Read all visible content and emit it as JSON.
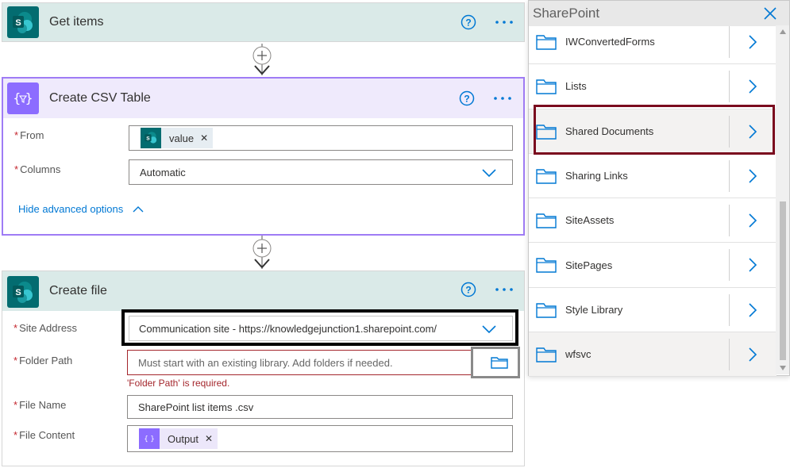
{
  "get_items": {
    "title": "Get items"
  },
  "csv_table": {
    "title": "Create CSV Table",
    "from_label": "From",
    "from_token": "value",
    "columns_label": "Columns",
    "columns_value": "Automatic",
    "advanced_link": "Hide advanced options"
  },
  "create_file": {
    "title": "Create file",
    "site_label": "Site Address",
    "site_value": "Communication site - https://knowledgejunction1.sharepoint.com/",
    "folder_label": "Folder Path",
    "folder_placeholder": "Must start with an existing library. Add folders if needed.",
    "folder_error": "'Folder Path' is required.",
    "filename_label": "File Name",
    "filename_value": "SharePoint list items .csv",
    "content_label": "File Content",
    "content_token": "Output"
  },
  "picker": {
    "title": "SharePoint",
    "items": [
      {
        "label": "IWConvertedForms"
      },
      {
        "label": "Lists"
      },
      {
        "label": "Shared Documents"
      },
      {
        "label": "Sharing Links"
      },
      {
        "label": "SiteAssets"
      },
      {
        "label": "SitePages"
      },
      {
        "label": "Style Library"
      },
      {
        "label": "wfsvc"
      }
    ],
    "selected": "Shared Documents"
  },
  "colors": {
    "sharepoint_teal": "#036c70",
    "sharepoint_header": "#daeae8",
    "data_operation_purple": "#8c6cff",
    "csv_header": "#efeafc",
    "link_blue": "#0078d4",
    "error_red": "#a4262c",
    "highlight_maroon": "#7a0a1e"
  }
}
